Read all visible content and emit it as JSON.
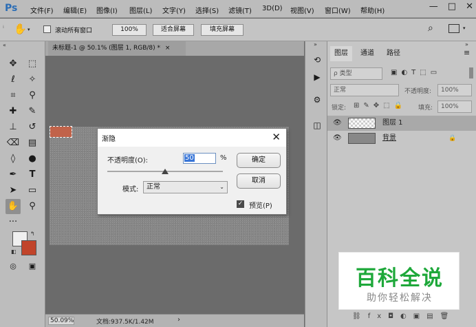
{
  "app": {
    "logo": "Ps"
  },
  "menu": [
    "文件(F)",
    "编辑(E)",
    "图像(I)",
    "图层(L)",
    "文字(Y)",
    "选择(S)",
    "滤镜(T)",
    "3D(D)",
    "视图(V)",
    "窗口(W)",
    "帮助(H)"
  ],
  "window_controls": {
    "minimize": "—",
    "maximize": "□",
    "close": "✕"
  },
  "options_bar": {
    "scroll_all_label": "滚动所有窗口",
    "zoom_value": "100%",
    "fit_screen": "适合屏幕",
    "fill_screen": "填充屏幕"
  },
  "document": {
    "tab_title": "未标题-1 @ 50.1% (图层 1, RGB/8) *",
    "tab_close": "×",
    "status_zoom": "50.09%",
    "status_info": "文档:937.5K/1.42M",
    "status_arrow": "›"
  },
  "layers_panel": {
    "tabs": [
      "图层",
      "通道",
      "路径"
    ],
    "kind_filter": "ρ 类型",
    "blend_mode": "正常",
    "opacity_label": "不透明度:",
    "opacity_value": "100%",
    "lock_label": "锁定:",
    "fill_label": "填充:",
    "fill_value": "100%",
    "layers": [
      {
        "name": "图层 1",
        "selected": true
      },
      {
        "name": "背景",
        "selected": false
      }
    ]
  },
  "dialog": {
    "title": "渐隐",
    "opacity_label": "不透明度(O):",
    "opacity_value": "50",
    "opacity_unit": "%",
    "opacity_level": 0.5,
    "mode_label": "模式:",
    "mode_value": "正常",
    "ok": "确定",
    "cancel": "取消",
    "preview_label": "预览(P)",
    "preview_checked": true
  },
  "watermark": {
    "main": "百科全说",
    "sub": "助你轻松解决"
  },
  "colors": {
    "foreground": "#f0f0f0",
    "background": "#c1442a",
    "selection": "#c1634a",
    "watermark_green": "#1ea83a"
  }
}
